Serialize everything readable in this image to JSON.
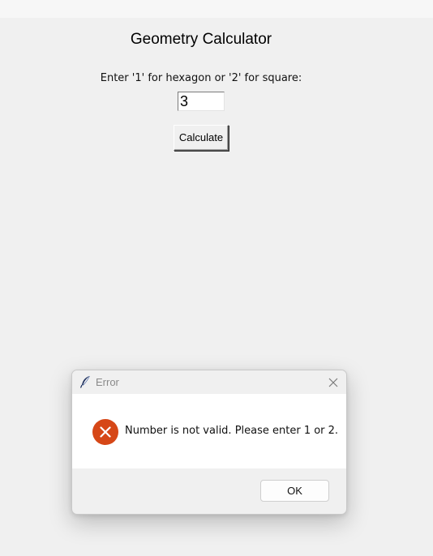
{
  "app": {
    "title": "Geometry Calculator",
    "prompt": "Enter '1' for hexagon or '2' for square:",
    "input_value": "3",
    "calculate_label": "Calculate"
  },
  "dialog": {
    "title": "Error",
    "message": "Number is not valid. Please enter 1 or 2.",
    "ok_label": "OK",
    "icons": {
      "title_icon": "feather-icon",
      "close_icon": "close-icon",
      "message_icon": "error-icon"
    },
    "colors": {
      "error_icon": "#d64717"
    }
  }
}
